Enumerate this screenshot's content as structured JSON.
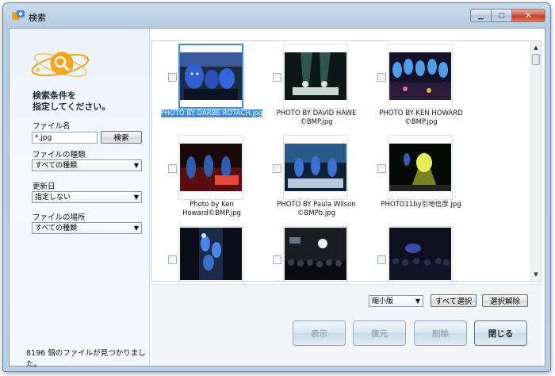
{
  "window": {
    "title": "検索"
  },
  "search_panel": {
    "prompt_line1": "検索条件を",
    "prompt_line2": "指定してください。",
    "filename_label": "ファイル名",
    "filename_value": "*.jpg",
    "search_button": "検索",
    "filetype_label": "ファイルの種類",
    "filetype_value": "すべての種類",
    "updated_label": "更新日",
    "updated_value": "指定しない",
    "location_label": "ファイルの場所",
    "location_value": "すべての種類",
    "status": "8196 個のファイルが見つかりました。"
  },
  "results": [
    {
      "caption": "PHOTO BY DARBE ROTACH.jpg",
      "selected": true
    },
    {
      "caption": "PHOTO BY DAVID HAWE ©BMP.jpg",
      "selected": false
    },
    {
      "caption": "PHOTO BY KEN HOWARD ©BMP.jpg",
      "selected": false
    },
    {
      "caption": "Photo by Ken Howard©BMP.jpg",
      "selected": false
    },
    {
      "caption": "PHOTO BY Paula Wilson ©BMPb.jpg",
      "selected": false
    },
    {
      "caption": "PHOTO11by引地信彦.jpg",
      "selected": false
    },
    {
      "caption": "",
      "selected": false
    },
    {
      "caption": "",
      "selected": false
    },
    {
      "caption": "",
      "selected": false
    }
  ],
  "toolbar": {
    "view_mode": "縮小版",
    "select_all": "すべて選択",
    "deselect": "選択解除",
    "show": "表示",
    "restore": "復元",
    "delete": "削除",
    "close": "閉じる"
  },
  "icons": [
    "app-icon",
    "search-logo-icon",
    "minimize-icon",
    "maximize-icon",
    "close-icon",
    "dropdown-arrow-icon",
    "scroll-up-icon",
    "scroll-down-icon"
  ]
}
